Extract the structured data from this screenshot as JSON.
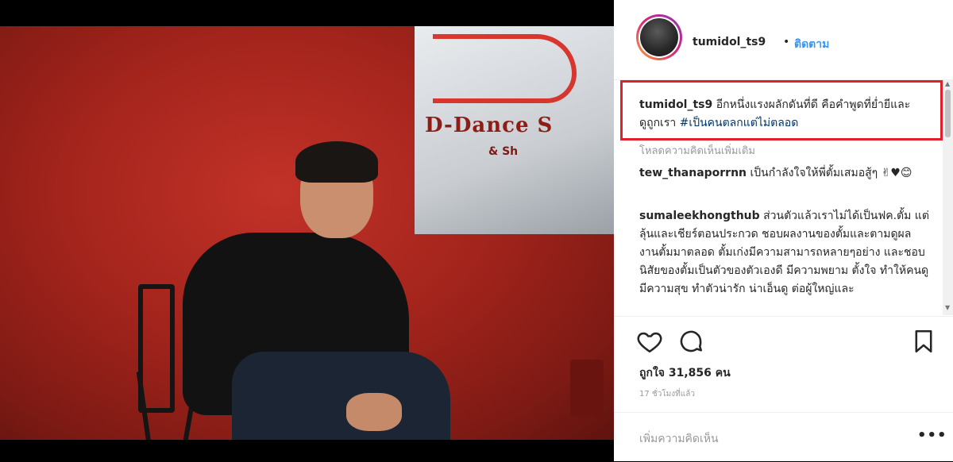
{
  "post": {
    "username": "tumidol_ts9",
    "separator": "•",
    "follow_label": "ติดตาม",
    "caption": {
      "username": "tumidol_ts9",
      "text": "อีกหนึ่งแรงผลักดันที่ดี คือคำพูดที่ย่ำยีและดูถูกเรา",
      "hashtag": "#เป็นคนตลกแต่ไม่ตลอด"
    },
    "load_more_label": "โหลดความคิดเห็นเพิ่มเติม",
    "comments": [
      {
        "username": "tew_thanaporrnn",
        "text": "เป็นกำลังใจให้พี่ตั้มเสมอสู้ๆ ✌♥😊"
      },
      {
        "username": "sumaleekhongthub",
        "text": "ส่วนตัวแล้วเราไม่ได้เป็นฟค.ตั้ม แต่ลุ้นและเชียร์ตอนประกวด ชอบผลงานของตั้มและตามดูผลงานตั้มมาตลอด ตั้มเก่งมีความสามารถหลายๆอย่าง และชอบนิสัยของตั้มเป็นตัวของตัวเองดี มีความพยาม ตั้งใจ ทำให้คนดูมีความสุข ทำตัวน่ารัก น่าเอ็นดู ต่อผู้ใหญ่และ"
      }
    ],
    "likes_label": "ถูกใจ 31,856 คน",
    "time_label": "17 ชั่วโมงที่แล้ว",
    "add_comment_placeholder": "เพิ่มความคิดเห็น",
    "more_icon": "•••"
  },
  "photo": {
    "sign_text": "D-Dance S",
    "sign_sub": "& Sh"
  },
  "icons": {
    "like": "heart-icon",
    "comment": "comment-icon",
    "save": "bookmark-icon",
    "more": "more-options-icon"
  },
  "colors": {
    "accent": "#3897f0",
    "highlight_border": "#e0202a",
    "photo_red": "#a3241c"
  }
}
